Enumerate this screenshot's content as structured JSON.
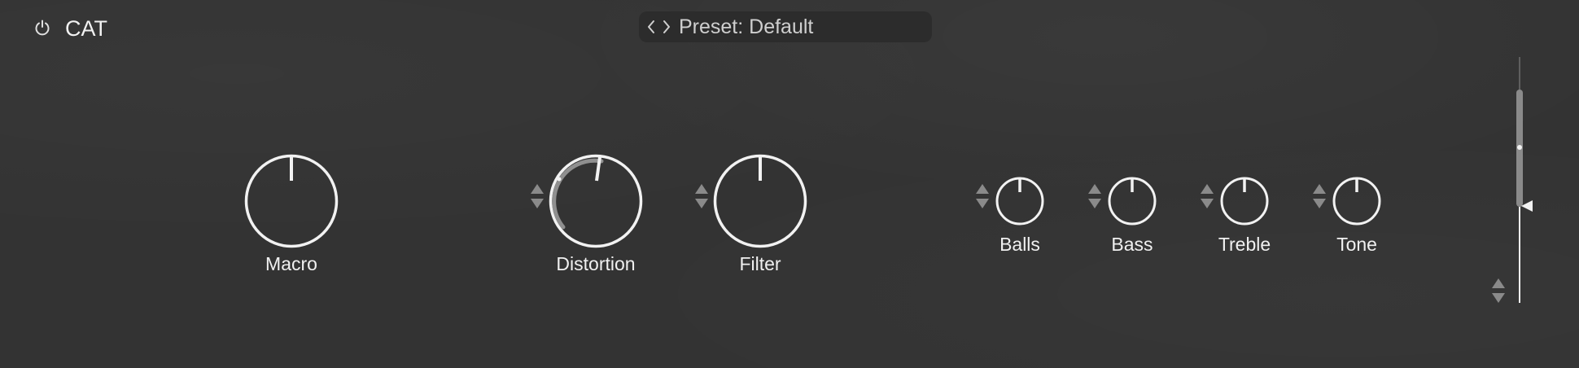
{
  "header": {
    "plugin_name": "CAT",
    "preset_text": "Preset: Default"
  },
  "icons": {
    "power": "power-icon",
    "prev": "chevron-left-icon",
    "next": "chevron-right-icon",
    "up": "triangle-up-icon",
    "down": "triangle-down-icon"
  },
  "knobs": {
    "macro": {
      "label": "Macro",
      "value": 0.5
    },
    "distortion": {
      "label": "Distortion",
      "value": 0.55
    },
    "filter": {
      "label": "Filter",
      "value": 0.5
    },
    "balls": {
      "label": "Balls",
      "value": 0.5
    },
    "bass": {
      "label": "Bass",
      "value": 0.5
    },
    "treble": {
      "label": "Treble",
      "value": 0.5
    },
    "tone": {
      "label": "Tone",
      "value": 0.5
    }
  },
  "output_meter": {
    "level_fraction": 0.7,
    "handle_fraction": 0.58
  },
  "colors": {
    "background": "#333333",
    "knob_stroke": "#f2f2f2",
    "arc": "#8f8f8f",
    "stepper": "#8a8a8a"
  }
}
